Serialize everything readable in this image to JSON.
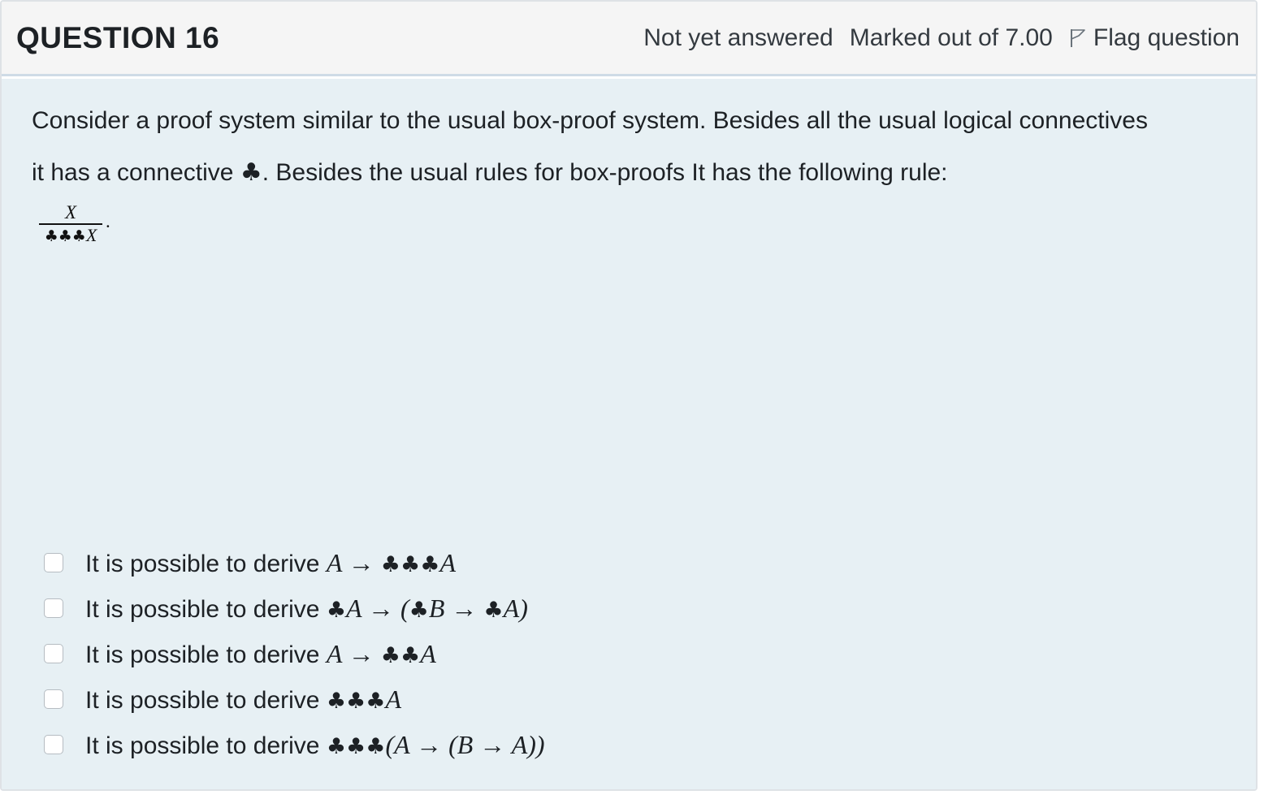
{
  "question": {
    "title": "QUESTION 16",
    "status": "Not yet answered",
    "marks": "Marked out of 7.00",
    "flag_label": "Flag question",
    "text_line1": "Consider a proof system similar to the usual box-proof system.  Besides all the usual logical connectives",
    "text_line2_a": "it has a  connective ",
    "text_line2_club": "♣",
    "text_line2_b": ". Besides the usual rules for box-proofs It has the following rule:",
    "rule_numerator": "X",
    "rule_denominator": "♣♣♣X",
    "rule_suffix": "."
  },
  "answers": [
    {
      "prefix": "It is possible to derive ",
      "formula": "A  →  ♣♣♣A",
      "checked": false
    },
    {
      "prefix": "It is possible to derive ",
      "formula": "♣A  →  (♣B  →  ♣A)",
      "checked": false
    },
    {
      "prefix": "It is possible to derive ",
      "formula": "A  →  ♣♣A",
      "checked": false
    },
    {
      "prefix": "It is possible to derive ",
      "formula": "♣♣♣A",
      "checked": false
    },
    {
      "prefix": "It is possible to derive ",
      "formula": "♣♣♣(A  →  (B  →  A))",
      "checked": false
    }
  ],
  "colors": {
    "header_bg": "#f5f5f5",
    "content_bg": "#e7f0f4",
    "header_divider": "#cfdbe6"
  }
}
